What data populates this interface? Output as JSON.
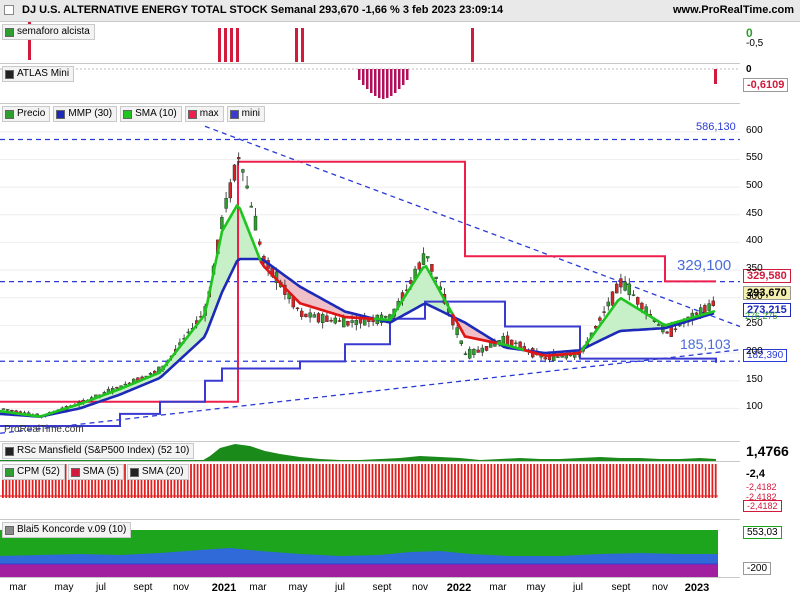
{
  "header": {
    "title": "DJ U.S. ALTERNATIVE ENERGY TOTAL STOCK Semanal 293,670 -1,66 % 3 feb 2023 23:09:14",
    "brand": "www.ProRealTime.com"
  },
  "watermark": "ProRealTime.com",
  "panes": {
    "semaforo": {
      "label": "semaforo alcista",
      "axis": [
        "0",
        "-0,5"
      ]
    },
    "atlas": {
      "label": "ATLAS Mini",
      "axis": [
        "0"
      ],
      "tag": "-0,6109"
    },
    "main": {
      "legend": [
        "Precio",
        "MMP (30)",
        "SMA (10)",
        "max",
        "mini"
      ],
      "y_ticks": [
        "600",
        "550",
        "500",
        "450",
        "400",
        "350",
        "300",
        "250",
        "200",
        "150",
        "100"
      ],
      "level_labels": [
        "586,130",
        "329,100",
        "185,103",
        "182,390"
      ],
      "price_tags": [
        "329,580",
        "293,670",
        "273,215",
        "276,275"
      ]
    },
    "rsc": {
      "label": "RSc Mansfield (S&P500 Index) (52 10)",
      "tag": "1,4766"
    },
    "cpm": {
      "legend": [
        "CPM (52)",
        "SMA (5)",
        "SMA (20)"
      ],
      "axis": [
        "-2,4"
      ],
      "tags": [
        "-2,4182",
        "-2,4182",
        "-2,4182"
      ]
    },
    "blai5": {
      "label": "Blai5 Koncorde v.09 (10)",
      "tags": [
        "553,03",
        "-200"
      ]
    }
  },
  "x_axis": {
    "labels": [
      "mar",
      "may",
      "jul",
      "sept",
      "nov",
      "2021",
      "mar",
      "may",
      "jul",
      "sept",
      "nov",
      "2022",
      "mar",
      "may",
      "jul",
      "sept",
      "nov",
      "2023"
    ]
  },
  "colors": {
    "candle_up": "#2e9e2e",
    "candle_down": "#d22525",
    "mmp": "#1d2ab8",
    "sma": "#e01515",
    "max": "#ee1f4d",
    "mini": "#3a3ad0",
    "dashed": "#2a3ad6",
    "fill_green": "#c8f0c8",
    "fill_red": "#f0c0c8",
    "sma_green": "#1fc41f"
  },
  "chart_data": {
    "type": "candlestick",
    "title": "DJ U.S. ALTERNATIVE ENERGY TOTAL STOCK",
    "ylim": [
      50,
      625
    ],
    "grid": true,
    "horizontal_levels": [
      586.13,
      329.1,
      185.103,
      182.39
    ],
    "last_close": 293.67,
    "series": [
      {
        "name": "Precio",
        "x": [
          "2020-02",
          "2020-04",
          "2020-06",
          "2020-08",
          "2020-10",
          "2020-12",
          "2021-01",
          "2021-02",
          "2021-03",
          "2021-05",
          "2021-07",
          "2021-09",
          "2021-11",
          "2022-01",
          "2022-03",
          "2022-05",
          "2022-07",
          "2022-09",
          "2022-11",
          "2023-02"
        ],
        "values": [
          100,
          85,
          110,
          140,
          170,
          280,
          450,
          560,
          370,
          270,
          255,
          265,
          380,
          195,
          225,
          190,
          200,
          330,
          235,
          293.67
        ]
      },
      {
        "name": "MMP (30)",
        "values": [
          90,
          85,
          100,
          125,
          155,
          230,
          310,
          370,
          370,
          320,
          275,
          255,
          290,
          255,
          210,
          200,
          205,
          240,
          245,
          273.215
        ]
      },
      {
        "name": "SMA (10)",
        "values": [
          95,
          85,
          108,
          135,
          165,
          270,
          420,
          470,
          360,
          290,
          265,
          260,
          360,
          230,
          215,
          195,
          200,
          300,
          250,
          276.275
        ]
      },
      {
        "name": "max",
        "values": [
          112,
          112,
          112,
          112,
          112,
          112,
          112,
          546,
          546,
          546,
          546,
          546,
          546,
          375,
          375,
          375,
          375,
          375,
          329.58,
          329.58
        ]
      },
      {
        "name": "mini",
        "values": [
          68,
          68,
          68,
          90,
          112,
          150,
          172,
          172,
          172,
          185,
          216,
          262,
          293,
          293,
          248,
          248,
          190,
          190,
          190,
          182.39
        ]
      }
    ]
  }
}
